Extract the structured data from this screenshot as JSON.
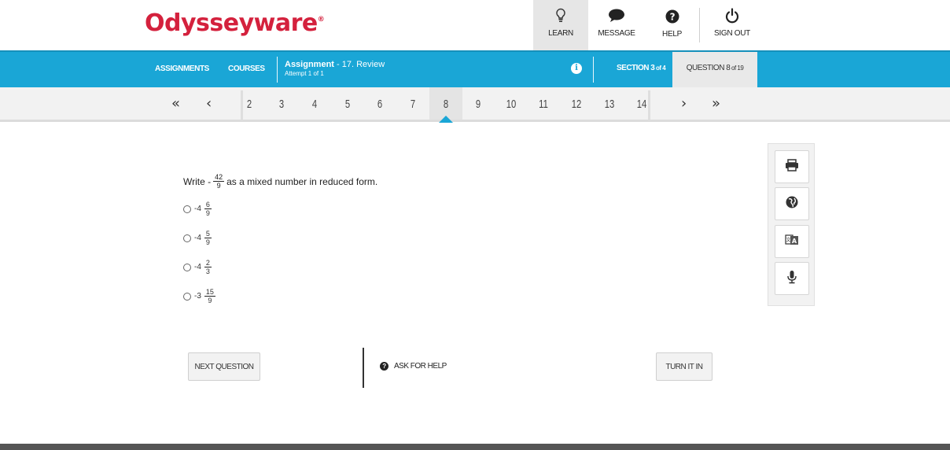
{
  "header": {
    "logo": "Odysseyware",
    "logo_mark": "®",
    "nav": [
      {
        "label": "LEARN",
        "icon": "lightbulb-icon"
      },
      {
        "label": "MESSAGE",
        "icon": "chat-bubble-icon"
      },
      {
        "label": "HELP",
        "icon": "question-circle-icon"
      },
      {
        "label": "SIGN OUT",
        "icon": "power-icon"
      }
    ]
  },
  "bluebar": {
    "assignments": "ASSIGNMENTS",
    "courses": "COURSES",
    "assignment_title": "Assignment",
    "assignment_name": " - 17. Review",
    "attempt": "Attempt 1 of 1",
    "section": "SECTION 3",
    "section_of": " of 4",
    "question": "QUESTION 8",
    "question_of": " of 19",
    "info_icon": "info-icon"
  },
  "qnav": {
    "first": "«",
    "prev": "‹",
    "next": "›",
    "last": "»",
    "numbers": [
      "2",
      "3",
      "4",
      "5",
      "6",
      "7",
      "8",
      "9",
      "10",
      "11",
      "12",
      "13",
      "14"
    ],
    "current": "8"
  },
  "question": {
    "prefix": "Write -",
    "frac_num": "42",
    "frac_den": "9",
    "suffix": "as a mixed number in reduced form.",
    "options": [
      {
        "whole": "-4",
        "num": "6",
        "den": "9"
      },
      {
        "whole": "-4",
        "num": "5",
        "den": "9"
      },
      {
        "whole": "-4",
        "num": "2",
        "den": "3"
      },
      {
        "whole": "-3",
        "num": "15",
        "den": "9"
      }
    ]
  },
  "tools": [
    "printer-icon",
    "globe-icon",
    "translate-icon",
    "microphone-icon"
  ],
  "buttons": {
    "next_question": "NEXT QUESTION",
    "ask_for_help": "ASK FOR HELP",
    "turn_it_in": "TURN IT IN"
  },
  "colors": {
    "brand_red": "#d4213d",
    "bar_blue": "#1aa6d6"
  }
}
